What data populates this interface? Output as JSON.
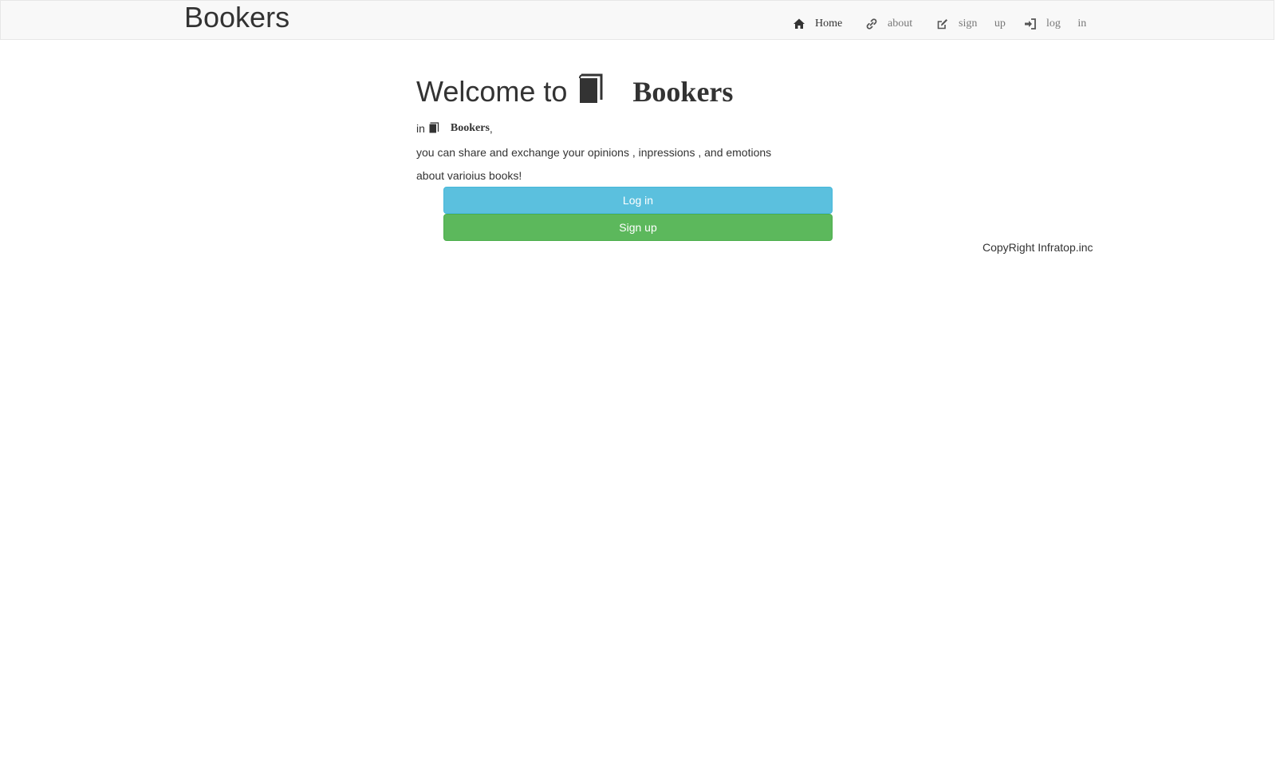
{
  "navbar": {
    "brand": "Bookers",
    "items": [
      {
        "label": "Home",
        "icon": "home-icon",
        "active": true
      },
      {
        "label": "about",
        "icon": "link-icon",
        "active": false
      },
      {
        "label": "sign up",
        "icon": "edit-icon",
        "active": false
      },
      {
        "label": "log in",
        "icon": "log-in-icon",
        "active": false
      }
    ]
  },
  "main": {
    "welcome_prefix": "Welcome to",
    "welcome_brand": "Bookers",
    "intro_prefix": "in",
    "intro_brand": "Bookers",
    "intro_suffix": ",",
    "line1": "you can share and exchange your opinions , inpressions , and emotions",
    "line2": "about varioius books!",
    "login_button": "Log in",
    "signup_button": "Sign up"
  },
  "footer": {
    "copyright": "CopyRight Infratop.inc"
  },
  "colors": {
    "navbar_bg": "#f8f8f8",
    "login_button": "#5bc0de",
    "signup_button": "#5cb85c",
    "text": "#333333",
    "nav_muted": "#777777"
  }
}
